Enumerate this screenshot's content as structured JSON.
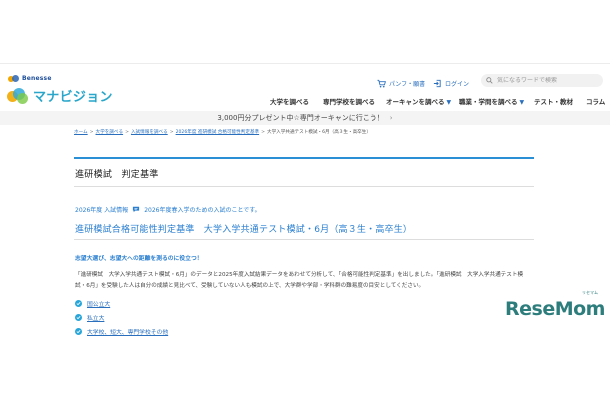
{
  "header": {
    "brand_small": "Benesse",
    "brand_main": "マナビジョン",
    "cart_label": "パンフ・願書",
    "login_label": "ログイン",
    "search_placeholder": "気になるワードで検索"
  },
  "nav": {
    "items": [
      {
        "label": "大学を調べる",
        "has_menu": false
      },
      {
        "label": "専門学校を調べる",
        "has_menu": false
      },
      {
        "label": "オーキャンを調べる",
        "has_menu": true
      },
      {
        "label": "職業・学問を調べる",
        "has_menu": true
      },
      {
        "label": "テスト・教材",
        "has_menu": false
      },
      {
        "label": "コラム",
        "has_menu": false
      }
    ]
  },
  "promo": {
    "text": "3,000円分プレゼント中☆専門オーキャンに行こう！"
  },
  "breadcrumb": {
    "items": [
      "ホーム",
      "大学を調べる",
      "入試情報を調べる",
      "2026年度 進研模試 合格可能性判定基準"
    ],
    "current": "大学入学共通テスト模試・6月（高３生・高卒生）"
  },
  "page": {
    "title": "進研模試　判定基準",
    "meta_year": "2026年度 入試情報",
    "meta_note": "2026年度春入学のための入試のことです。",
    "exam_title": "進研模試合格可能性判定基準　大学入学共通テスト模試・6月（高３生・高卒生）",
    "lead": "志望大選び、志望大への距離を測るのに役立つ！",
    "body": "「進研模試　大学入学共通テスト模試・6月」のデータと2025年度入試結果データをあわせて分析して、「合格可能性判定基準」を出しました。「進研模試　大学入学共通テスト模試・6月」を受験した人は自分の成績と見比べて、受験していない人も模試の上で、大学群や学部・学科群の難易度の目安としてください。",
    "links": [
      {
        "label": "国公立大"
      },
      {
        "label": "私立大"
      },
      {
        "label": "大学校、短大、専門学校その他"
      }
    ]
  },
  "watermark": {
    "text": "ReseMom",
    "ruby": "リセマム"
  },
  "colors": {
    "accent": "#2a7fd0",
    "title_bar": "#2b8fd6",
    "brand": "#29a6c9"
  }
}
